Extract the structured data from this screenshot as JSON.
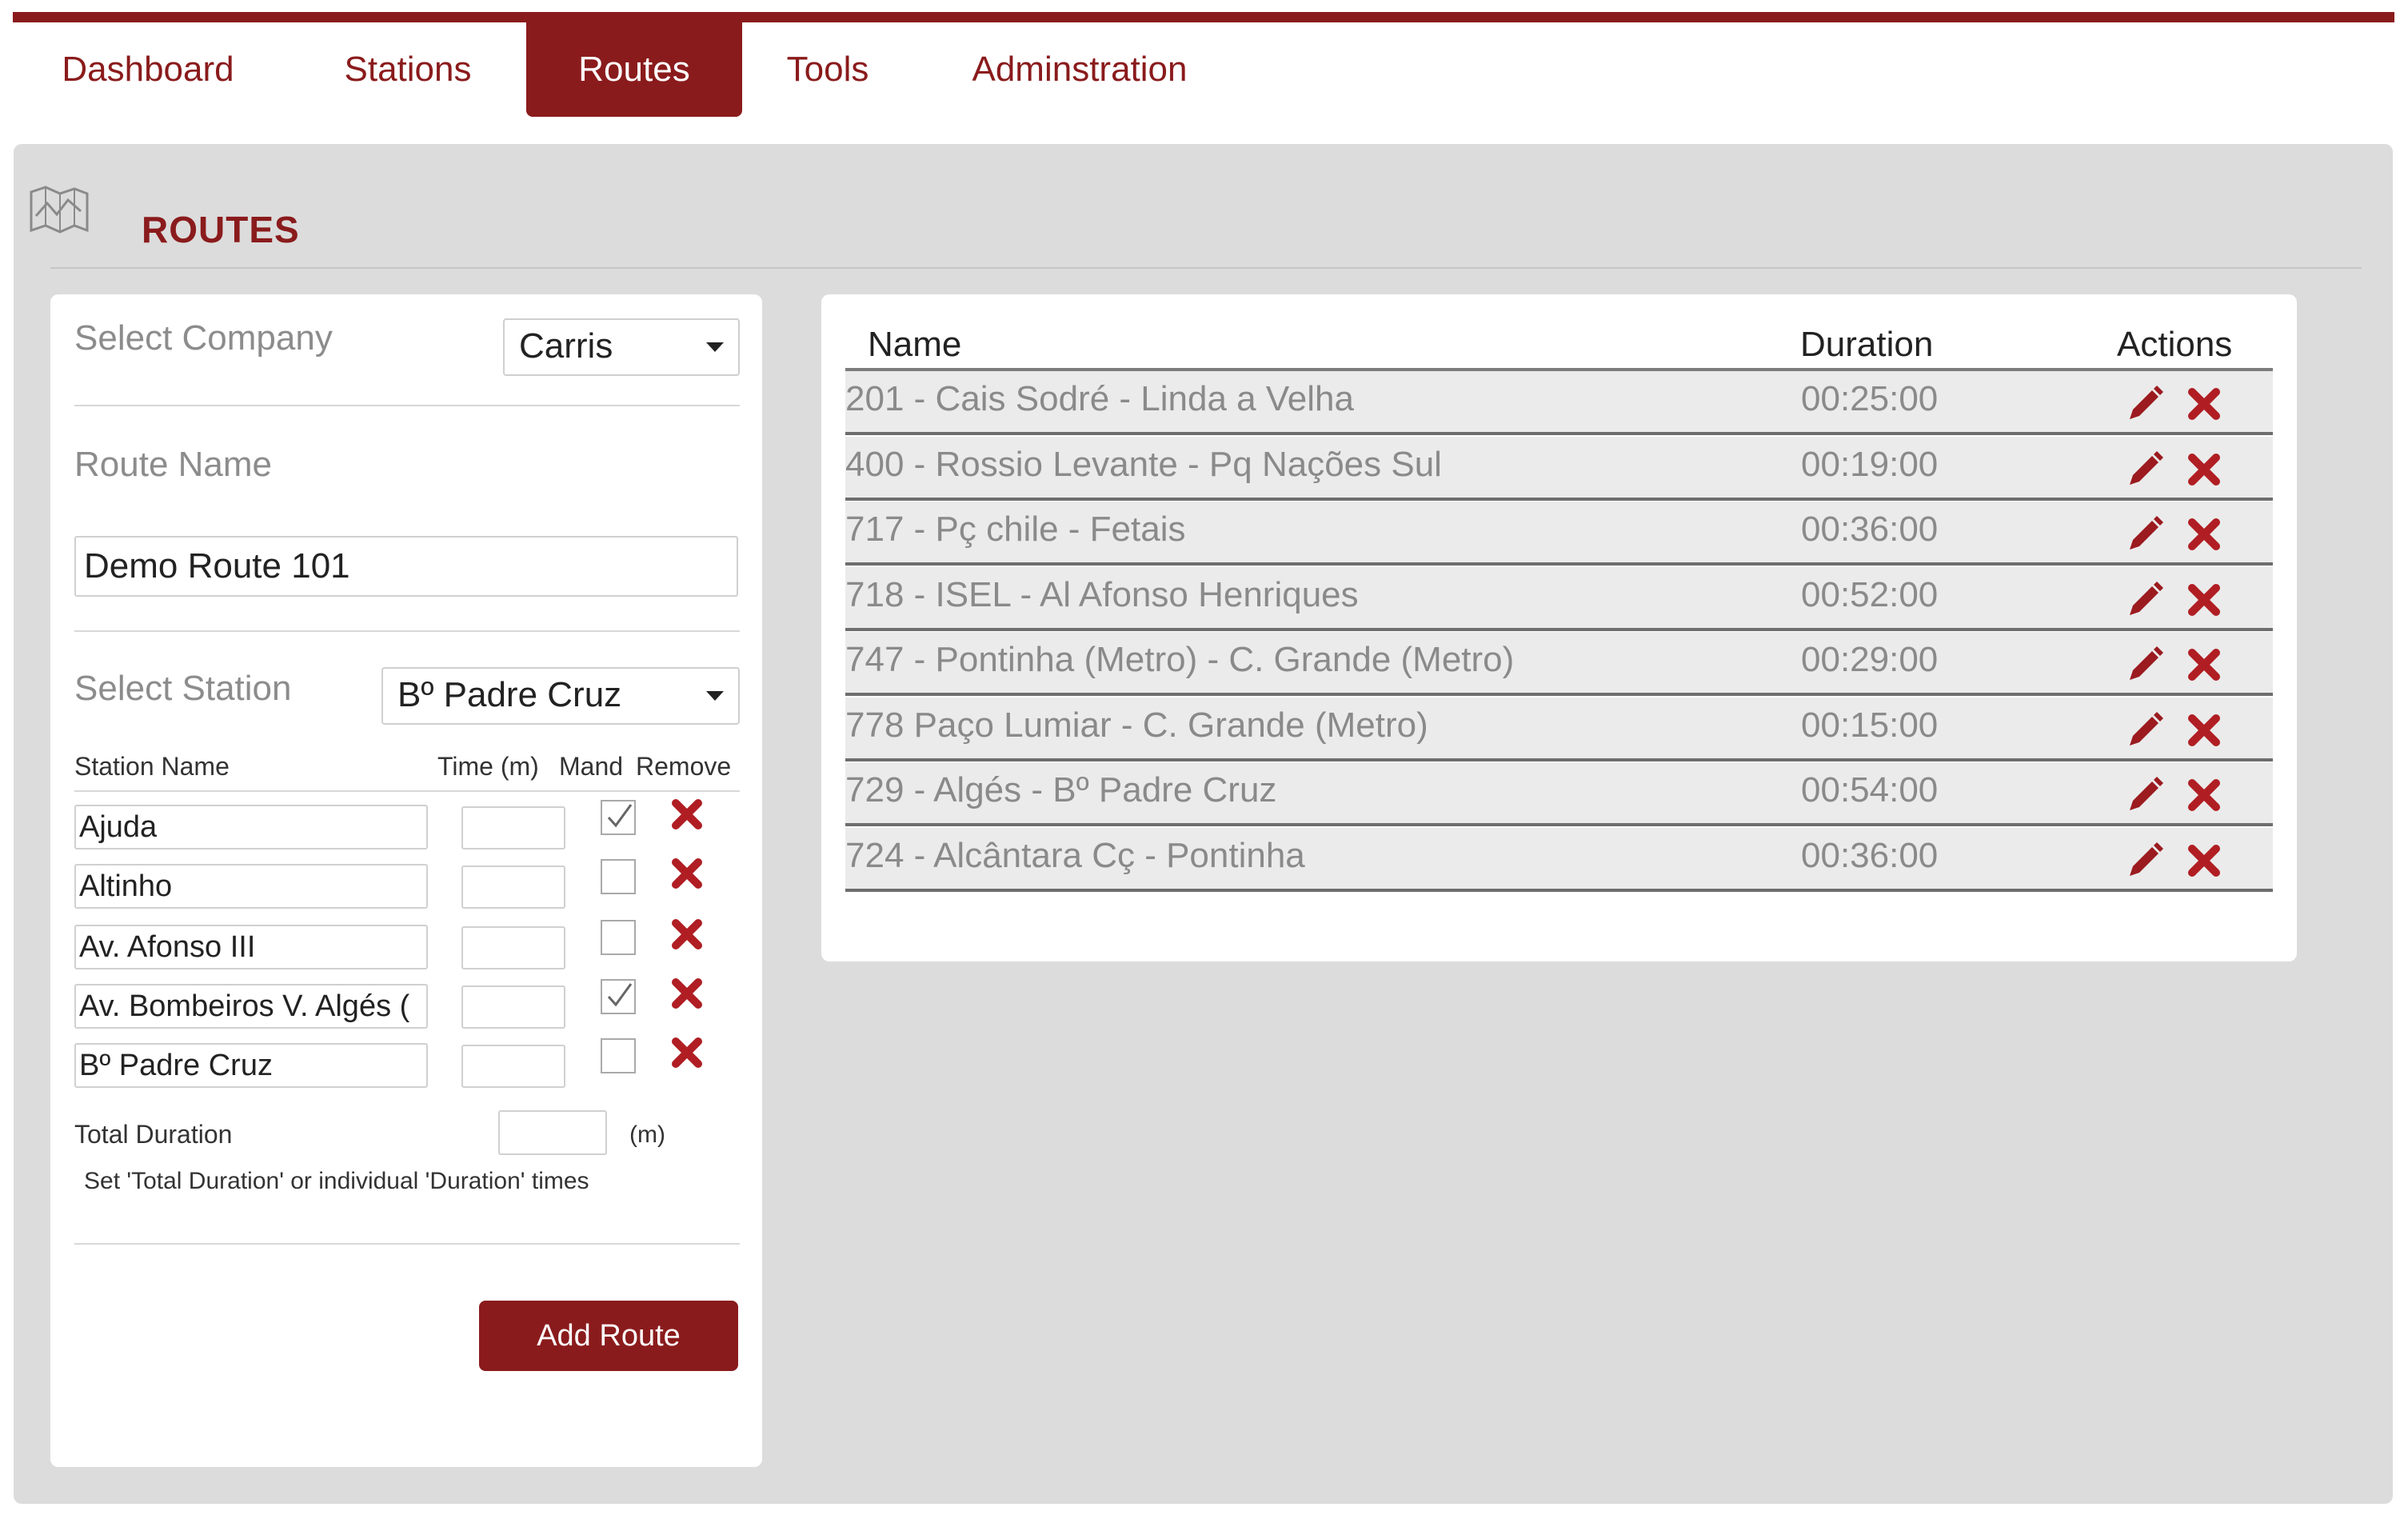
{
  "nav": {
    "items": [
      {
        "label": "Dashboard",
        "active": false
      },
      {
        "label": "Stations",
        "active": false
      },
      {
        "label": "Routes",
        "active": true
      },
      {
        "label": "Tools",
        "active": false
      },
      {
        "label": "Adminstration",
        "active": false
      }
    ]
  },
  "page": {
    "title": "ROUTES",
    "icon": "map-icon"
  },
  "form": {
    "company_label": "Select Company",
    "company_value": "Carris",
    "route_name_label": "Route Name",
    "route_name_value": "Demo Route 101",
    "station_label": "Select Station",
    "station_value": "Bº Padre Cruz",
    "columns": {
      "name": "Station Name",
      "time": "Time (m)",
      "mand": "Mand",
      "remove": "Remove"
    },
    "stations": [
      {
        "name": "Ajuda",
        "time": "",
        "mandatory": true
      },
      {
        "name": "Altinho",
        "time": "",
        "mandatory": false
      },
      {
        "name": "Av. Afonso III",
        "time": "",
        "mandatory": false
      },
      {
        "name": "Av. Bombeiros V. Algés (",
        "time": "",
        "mandatory": true
      },
      {
        "name": "Bº Padre Cruz",
        "time": "",
        "mandatory": false
      }
    ],
    "total_label": "Total Duration",
    "total_value": "",
    "total_unit": "(m)",
    "hint": "Set 'Total Duration' or individual 'Duration' times",
    "add_button": "Add Route"
  },
  "table": {
    "headers": {
      "name": "Name",
      "duration": "Duration",
      "actions": "Actions"
    },
    "rows": [
      {
        "name": "201 - Cais Sodré - Linda a Velha",
        "duration": "00:25:00"
      },
      {
        "name": "400 - Rossio Levante - Pq Nações Sul",
        "duration": "00:19:00"
      },
      {
        "name": "717 - Pç chile - Fetais",
        "duration": "00:36:00"
      },
      {
        "name": "718 - ISEL - Al Afonso Henriques",
        "duration": "00:52:00"
      },
      {
        "name": "747 - Pontinha (Metro) - C. Grande (Metro)",
        "duration": "00:29:00"
      },
      {
        "name": "778 Paço Lumiar - C. Grande (Metro)",
        "duration": "00:15:00"
      },
      {
        "name": "729 - Algés - Bº Padre Cruz",
        "duration": "00:54:00"
      },
      {
        "name": "724 - Alcântara Cç - Pontinha",
        "duration": "00:36:00"
      }
    ]
  },
  "colors": {
    "accent": "#8a1b1c",
    "panel": "#dcdcdc",
    "row": "#ebebeb"
  }
}
